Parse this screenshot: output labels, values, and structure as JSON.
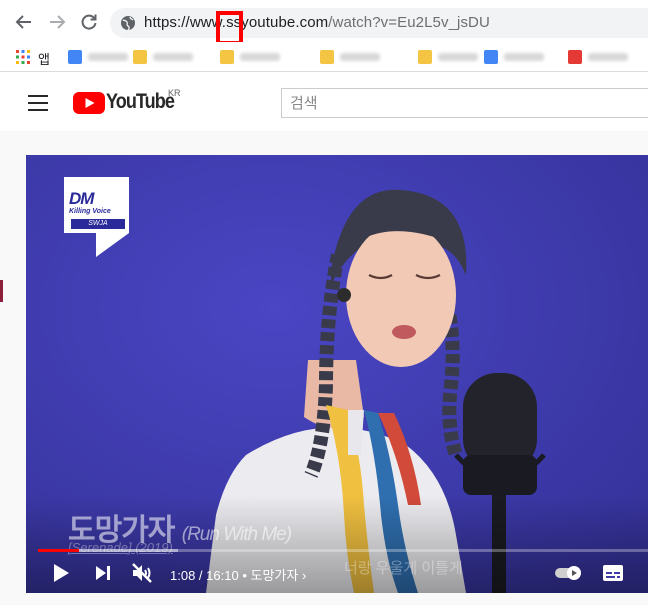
{
  "browser": {
    "url_prefix": "https://www.",
    "url_highlight": "ss",
    "url_domain": "youtube.com",
    "url_path": "/watch?v=Eu2L5v_jsDU",
    "apps_label": "앱",
    "bookmark_favicon_colors": [
      "#4285f4",
      "#f4c542",
      "#f4c542",
      "#f4c542",
      "#f4c542",
      "#4285f4",
      "#e53935"
    ]
  },
  "youtube": {
    "logo_text": "YouTube",
    "region": "KR",
    "search_placeholder": "검색",
    "brand_color": "#ff0000"
  },
  "video": {
    "badge_title": "DM",
    "badge_subtitle": "Killing Voice",
    "badge_tag": "SWJA",
    "song_title_ko": "도망가자",
    "song_title_en": "(Run With Me)",
    "song_subtitle": "[Serenade] (2019)",
    "lyric": "너랑 우울게 이틀게",
    "progress": 0.067,
    "current_time": "1:08",
    "duration": "16:10",
    "chapter": "도망가자"
  }
}
